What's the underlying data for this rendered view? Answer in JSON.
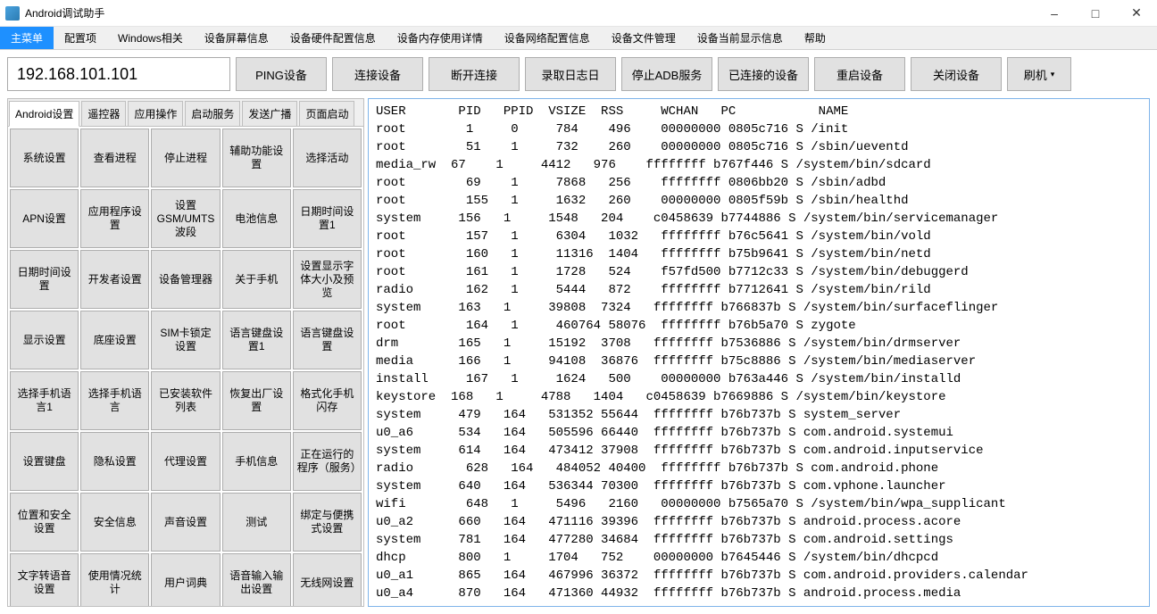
{
  "window": {
    "title": "Android调试助手"
  },
  "menubar": [
    "主菜单",
    "配置项",
    "Windows相关",
    "设备屏幕信息",
    "设备硬件配置信息",
    "设备内存使用详情",
    "设备网络配置信息",
    "设备文件管理",
    "设备当前显示信息",
    "帮助"
  ],
  "toolbar": {
    "ip": "192.168.101.101",
    "buttons": [
      "PING设备",
      "连接设备",
      "断开连接",
      "录取日志日",
      "停止ADB服务",
      "已连接的设备",
      "重启设备",
      "关闭设备"
    ],
    "combo": "刷机"
  },
  "left_tabs": [
    "Android设置",
    "遥控器",
    "应用操作",
    "启动服务",
    "发送广播",
    "页面启动"
  ],
  "left_tabs_active": 0,
  "grid": [
    "系统设置",
    "查看进程",
    "停止进程",
    "辅助功能设置",
    "选择活动",
    "APN设置",
    "应用程序设置",
    "设置GSM/UMTS波段",
    "电池信息",
    "日期时间设置1",
    "日期时间设置",
    "开发者设置",
    "设备管理器",
    "关于手机",
    "设置显示字体大小及预览",
    "显示设置",
    "底座设置",
    "SIM卡锁定设置",
    "语言键盘设置1",
    "语言键盘设置",
    "选择手机语言1",
    "选择手机语言",
    "已安装软件列表",
    "恢复出厂设置",
    "格式化手机闪存",
    "设置键盘",
    "隐私设置",
    "代理设置",
    "手机信息",
    "正在运行的程序（服务）",
    "位置和安全设置",
    "安全信息",
    "声音设置",
    "测试",
    "绑定与便携式设置",
    "文字转语音设置",
    "使用情况统计",
    "用户词典",
    "语音输入输出设置",
    "无线网设置"
  ],
  "log_header": "USER       PID   PPID  VSIZE  RSS     WCHAN   PC           NAME",
  "log_lines": [
    "root        1     0     784    496    00000000 0805c716 S /init",
    "root        51    1     732    260    00000000 0805c716 S /sbin/ueventd",
    "media_rw  67    1     4412   976    ffffffff b767f446 S /system/bin/sdcard",
    "root        69    1     7868   256    ffffffff 0806bb20 S /sbin/adbd",
    "root        155   1     1632   260    00000000 0805f59b S /sbin/healthd",
    "system     156   1     1548   204    c0458639 b7744886 S /system/bin/servicemanager",
    "root        157   1     6304   1032   ffffffff b76c5641 S /system/bin/vold",
    "root        160   1     11316  1404   ffffffff b75b9641 S /system/bin/netd",
    "root        161   1     1728   524    f57fd500 b7712c33 S /system/bin/debuggerd",
    "radio       162   1     5444   872    ffffffff b7712641 S /system/bin/rild",
    "system     163   1     39808  7324   ffffffff b766837b S /system/bin/surfaceflinger",
    "root        164   1     460764 58076  ffffffff b76b5a70 S zygote",
    "drm        165   1     15192  3708   ffffffff b7536886 S /system/bin/drmserver",
    "media      166   1     94108  36876  ffffffff b75c8886 S /system/bin/mediaserver",
    "install     167   1     1624   500    00000000 b763a446 S /system/bin/installd",
    "keystore  168   1     4788   1404   c0458639 b7669886 S /system/bin/keystore",
    "system     479   164   531352 55644  ffffffff b76b737b S system_server",
    "u0_a6      534   164   505596 66440  ffffffff b76b737b S com.android.systemui",
    "system     614   164   473412 37908  ffffffff b76b737b S com.android.inputservice",
    "radio       628   164   484052 40400  ffffffff b76b737b S com.android.phone",
    "system     640   164   536344 70300  ffffffff b76b737b S com.vphone.launcher",
    "wifi        648   1     5496   2160   00000000 b7565a70 S /system/bin/wpa_supplicant",
    "u0_a2      660   164   471116 39396  ffffffff b76b737b S android.process.acore",
    "system     781   164   477280 34684  ffffffff b76b737b S com.android.settings",
    "dhcp       800   1     1704   752    00000000 b7645446 S /system/bin/dhcpcd",
    "u0_a1      865   164   467996 36372  ffffffff b76b737b S com.android.providers.calendar",
    "u0_a4      870   164   471360 44932  ffffffff b76b737b S android.process.media"
  ]
}
